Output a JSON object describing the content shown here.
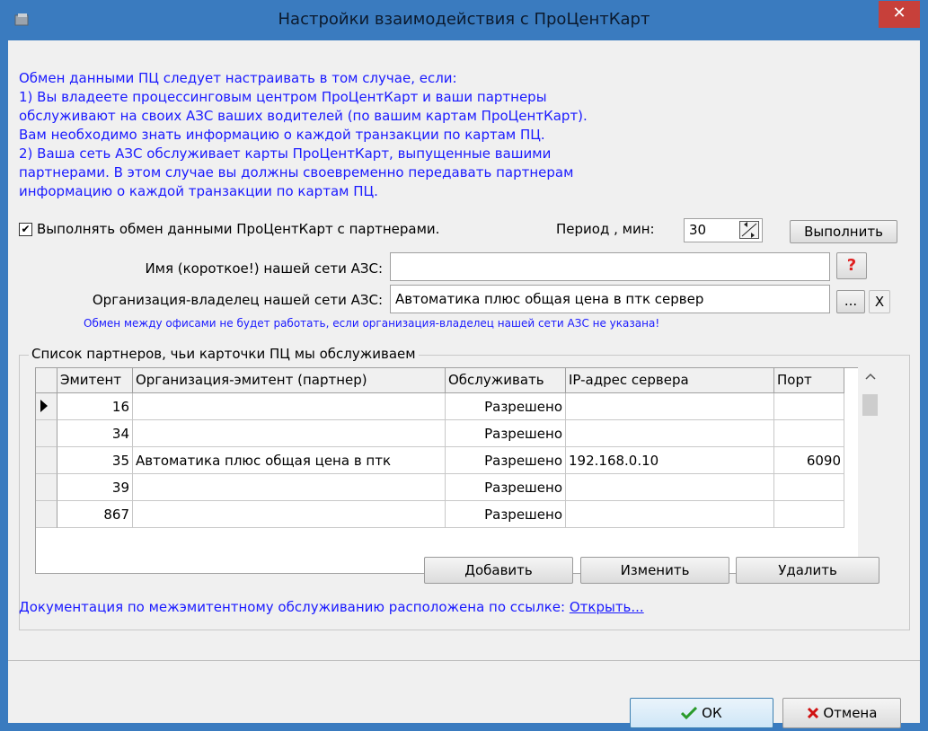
{
  "window": {
    "title": "Настройки взаимодействия с ПроЦентКарт",
    "close_glyph": "✕",
    "icon": "app-icon"
  },
  "info": {
    "lines": [
      "Обмен данными ПЦ следует настраивать в том случае, если:",
      "1) Вы владеете процессинговым центром ПроЦентКарт и ваши партнеры",
      "обслуживают на своих АЗС ваших водителей (по вашим картам ПроЦентКарт).",
      "Вам необходимо знать информацию о каждой транзакции по картам ПЦ.",
      "2) Ваша сеть АЗС обслуживает карты ПроЦентКарт, выпущенные вашими",
      "партнерами. В этом случае вы должны своевременно передавать партнерам",
      "информацию о каждой транзакции по картам ПЦ."
    ]
  },
  "exchange": {
    "checkbox_label": "Выполнять обмен данными ПроЦентКарт с партнерами.",
    "checked": true,
    "check_glyph": "✔",
    "period_label": "Период , мин:",
    "period_value": "30",
    "execute_label": "Выполнить"
  },
  "network": {
    "name_label": "Имя (короткое!) нашей сети АЗС:",
    "name_value": "",
    "help_glyph": "?",
    "owner_label": "Организация-владелец нашей сети АЗС:",
    "owner_value": "Автоматика плюс общая цена в птк сервер",
    "browse_label": "...",
    "clear_label": "X",
    "warning": "Обмен между офисами не будет работать, если организация-владелец нашей сети АЗС не указана!"
  },
  "partners": {
    "group_label": "Список партнеров, чьи карточки ПЦ мы обслуживаем",
    "columns": [
      "Эмитент",
      "Организация-эмитент (партнер)",
      "Обслуживать",
      "IP-адрес сервера",
      "Порт"
    ],
    "rows": [
      {
        "emitent": "16",
        "org": "",
        "serve": "Разрешено",
        "ip": "",
        "port": "",
        "current": true
      },
      {
        "emitent": "34",
        "org": "",
        "serve": "Разрешено",
        "ip": "",
        "port": "",
        "current": false
      },
      {
        "emitent": "35",
        "org": "Автоматика плюс общая цена в птк",
        "serve": "Разрешено",
        "ip": "192.168.0.10",
        "port": "6090",
        "current": false
      },
      {
        "emitent": "39",
        "org": "",
        "serve": "Разрешено",
        "ip": "",
        "port": "",
        "current": false
      },
      {
        "emitent": "867",
        "org": "",
        "serve": "Разрешено",
        "ip": "",
        "port": "",
        "current": false
      }
    ],
    "add_label": "Добавить",
    "edit_label": "Изменить",
    "delete_label": "Удалить"
  },
  "docs": {
    "text": "Документация по межэмитентному обслуживанию расположена по ссылке:",
    "link_label": "Открыть..."
  },
  "footer": {
    "ok_label": "ОК",
    "cancel_label": "Отмена"
  },
  "colors": {
    "title_bar": "#3a7bbf",
    "info_text": "#1a1aff",
    "close": "#c7403a"
  }
}
